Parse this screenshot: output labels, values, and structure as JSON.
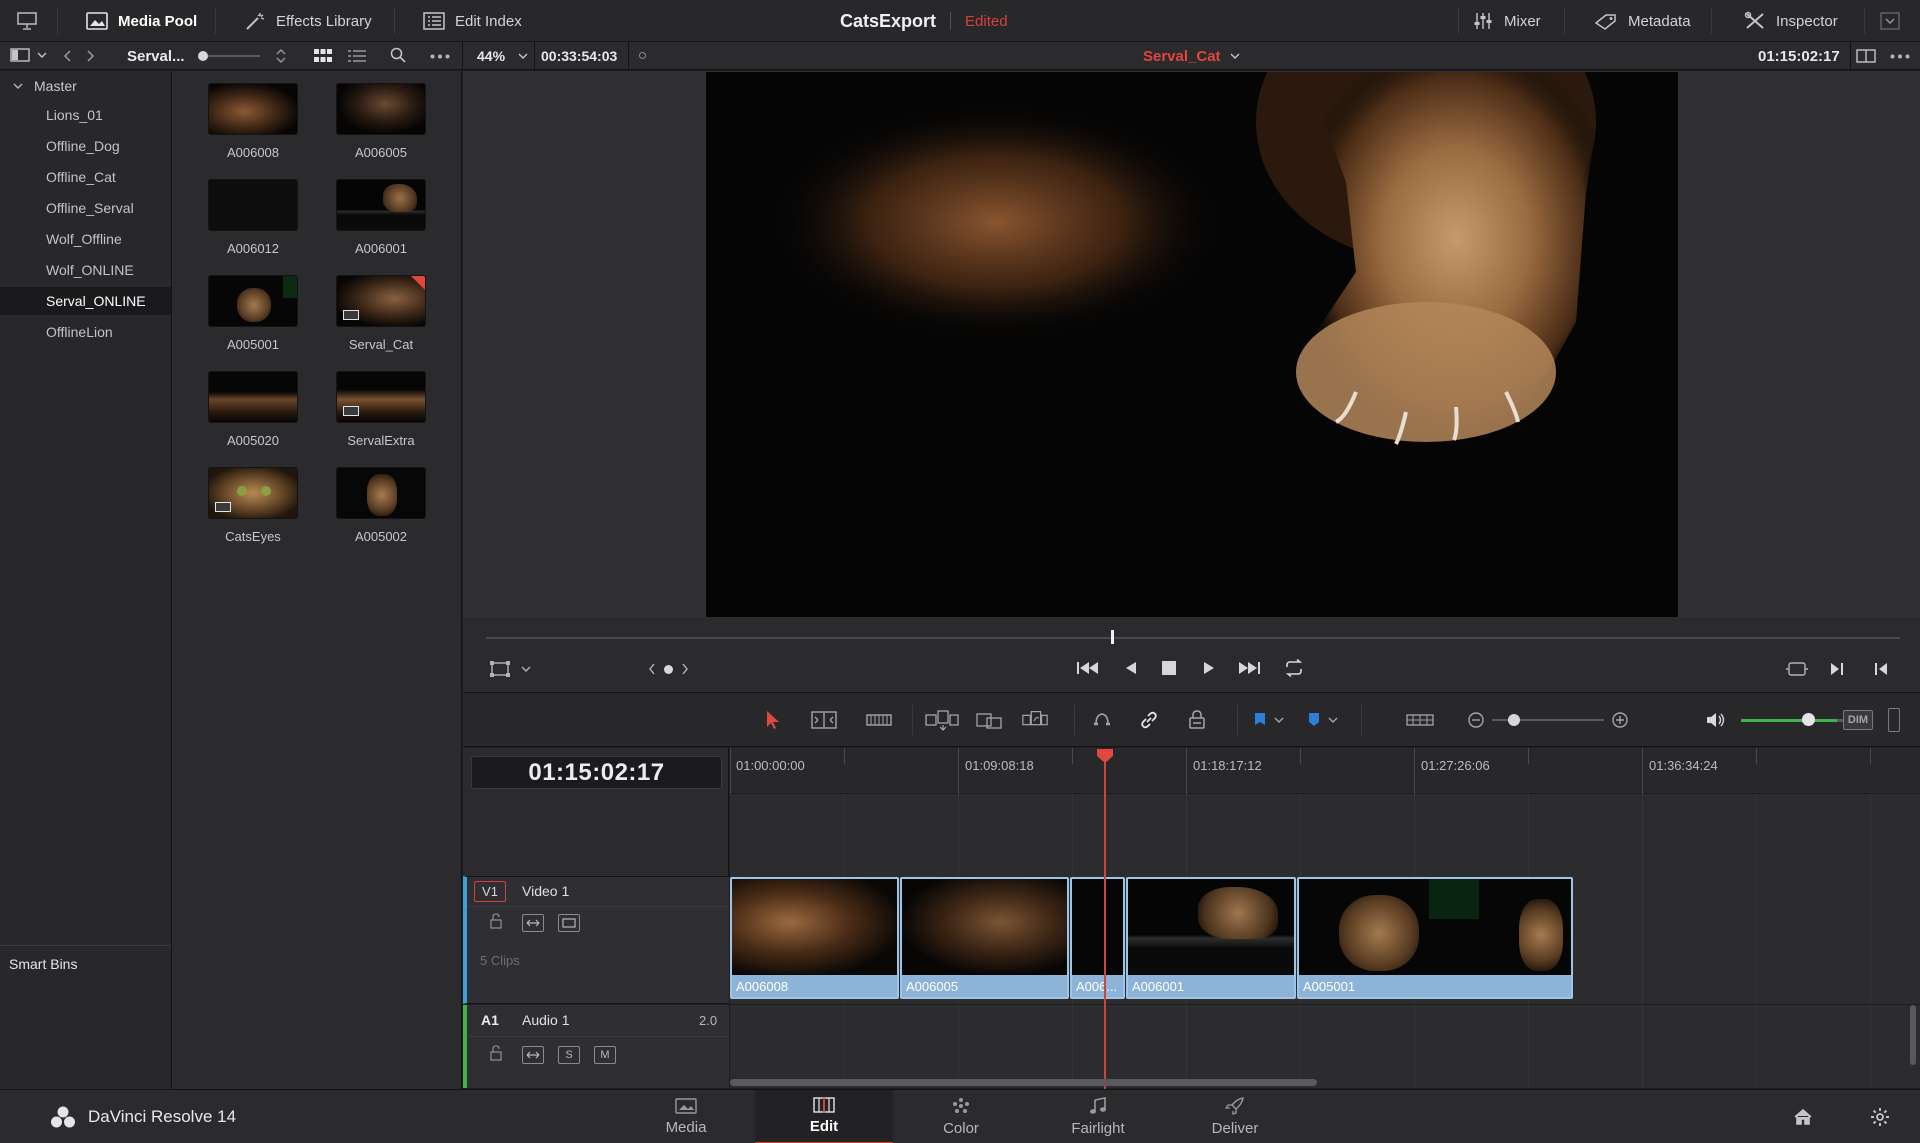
{
  "top_bar": {
    "media_pool": "Media Pool",
    "effects_library": "Effects Library",
    "edit_index": "Edit Index",
    "project_name": "CatsExport",
    "project_status": "Edited",
    "mixer": "Mixer",
    "metadata": "Metadata",
    "inspector": "Inspector"
  },
  "sub_bar": {
    "bin_name": "Serval...",
    "zoom": "44%",
    "source_timecode": "00:33:54:03",
    "clip_name": "Serval_Cat",
    "record_timecode": "01:15:02:17"
  },
  "bins": {
    "master": "Master",
    "items": [
      "Lions_01",
      "Offline_Dog",
      "Offline_Cat",
      "Offline_Serval",
      "Wolf_Offline",
      "Wolf_ONLINE",
      "Serval_ONLINE",
      "OfflineLion"
    ],
    "selected": "Serval_ONLINE",
    "smart_bins": "Smart Bins"
  },
  "clips": [
    {
      "name": "A006008"
    },
    {
      "name": "A006005"
    },
    {
      "name": "A006012"
    },
    {
      "name": "A006001"
    },
    {
      "name": "A005001"
    },
    {
      "name": "Serval_Cat"
    },
    {
      "name": "A005020"
    },
    {
      "name": "ServalExtra"
    },
    {
      "name": "CatsEyes"
    },
    {
      "name": "A005002"
    }
  ],
  "timeline": {
    "timecode": "01:15:02:17",
    "ruler": [
      "01:00:00:00",
      "01:09:08:18",
      "01:18:17:12",
      "01:27:26:06",
      "01:36:34:24"
    ],
    "video_track": {
      "code": "V1",
      "name": "Video 1",
      "clip_count": "5 Clips"
    },
    "audio_track": {
      "code": "A1",
      "name": "Audio 1",
      "channels": "2.0",
      "solo": "S",
      "mute": "M"
    },
    "video_clips": [
      "A006008",
      "A006005",
      "A006...",
      "A006001",
      "A005001"
    ],
    "dim_label": "DIM"
  },
  "pages": {
    "brand": "DaVinci Resolve 14",
    "tabs": [
      "Media",
      "Edit",
      "Color",
      "Fairlight",
      "Deliver"
    ],
    "active": "Edit"
  },
  "colors": {
    "accent_red": "#d6403a",
    "video_track": "#3fa0d6",
    "audio_track": "#3fb34a",
    "clip_blue": "#8db4d8"
  }
}
